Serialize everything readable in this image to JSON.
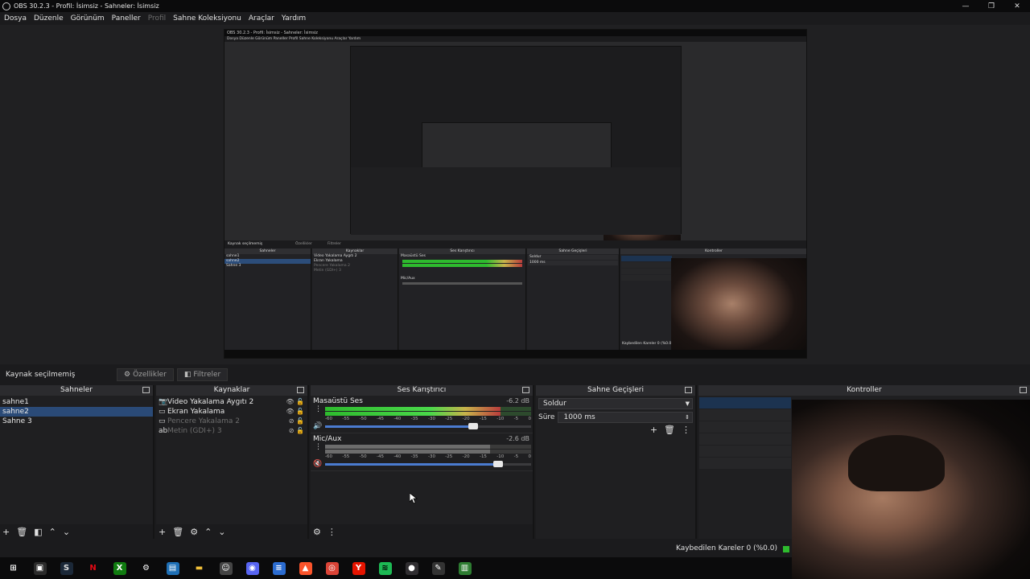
{
  "window": {
    "title": "OBS 30.2.3 - Profil: İsimsiz - Sahneler: İsimsiz",
    "controls": [
      "—",
      "❐",
      "✕"
    ]
  },
  "menu": {
    "items": [
      "Dosya",
      "Düzenle",
      "Görünüm",
      "Paneller",
      "Profil",
      "Sahne Koleksiyonu",
      "Araçlar",
      "Yardım"
    ]
  },
  "nested": {
    "title": "OBS 30.2.3 - Profil: İsimsiz - Sahneler: İsimsiz",
    "menu": "Dosya   Düzenle   Görünüm   Paneller   Profil   Sahne Koleksiyonu   Araçlar   Yardım",
    "source_status": "Kaynak seçilmemiş",
    "props": "Özellikler",
    "filters": "Filtreler",
    "scenes_head": "Sahneler",
    "sources_head": "Kaynaklar",
    "mixer_head": "Ses Karıştırıcı",
    "trans_head": "Sahne Geçişleri",
    "controls_head": "Kontroller",
    "scenes": [
      "sahne1",
      "sahne2",
      "Sahne 3"
    ],
    "sources": [
      "Video Yakalama Aygıtı 2",
      "Ekran Yakalama",
      "Pencere Yakalama 2",
      "Metin (GDI+) 3"
    ],
    "desktop_audio": "Masaüstü Ses",
    "mic": "Mic/Aux",
    "fade": "Soldur",
    "duration": "1000 ms",
    "dropped": "Kaybedilen Kareler 0 (%0.0)"
  },
  "source_bar": {
    "status": "Kaynak seçilmemiş",
    "properties_label": "Özellikler",
    "filters_label": "Filtreler"
  },
  "scenes": {
    "title": "Sahneler",
    "items": [
      "sahne1",
      "sahne2",
      "Sahne 3"
    ],
    "selected_index": 1
  },
  "sources": {
    "title": "Kaynaklar",
    "items": [
      {
        "name": "Video Yakalama Aygıtı 2",
        "icon": "camera-icon",
        "visible": true
      },
      {
        "name": "Ekran Yakalama",
        "icon": "monitor-icon",
        "visible": true
      },
      {
        "name": "Pencere Yakalama 2",
        "icon": "window-icon",
        "visible": false
      },
      {
        "name": "Metin (GDI+) 3",
        "icon": "text-icon",
        "visible": false
      }
    ]
  },
  "mixer": {
    "title": "Ses Karıştırıcı",
    "channels": [
      {
        "name": "Masaüstü Ses",
        "db": "-6.2 dB",
        "muted": false,
        "level": 0.85,
        "volume": 0.72
      },
      {
        "name": "Mic/Aux",
        "db": "-2.6 dB",
        "muted": true,
        "level": 0.8,
        "volume": 0.84
      }
    ],
    "scale": [
      "-60",
      "-55",
      "-50",
      "-45",
      "-40",
      "-35",
      "-30",
      "-25",
      "-20",
      "-15",
      "-10",
      "-5",
      "0"
    ]
  },
  "transitions": {
    "title": "Sahne Geçişleri",
    "selected": "Soldur",
    "duration_label": "Süre",
    "duration_value": "1000 ms"
  },
  "controls": {
    "title": "Kontroller"
  },
  "status": {
    "dropped_frames": "Kaybedilen Kareler 0 (%0.0)"
  },
  "taskbar": {
    "icons": [
      "windows-start-icon",
      "store-icon",
      "steam-icon",
      "netflix-icon",
      "xbox-icon",
      "settings-icon",
      "photos-icon",
      "folder-icon",
      "finder-icon",
      "discord-icon",
      "notes-icon",
      "brave-icon",
      "chrome-icon",
      "yandex-icon",
      "spotify-icon",
      "obs-icon",
      "tool-icon",
      "app-icon"
    ]
  }
}
